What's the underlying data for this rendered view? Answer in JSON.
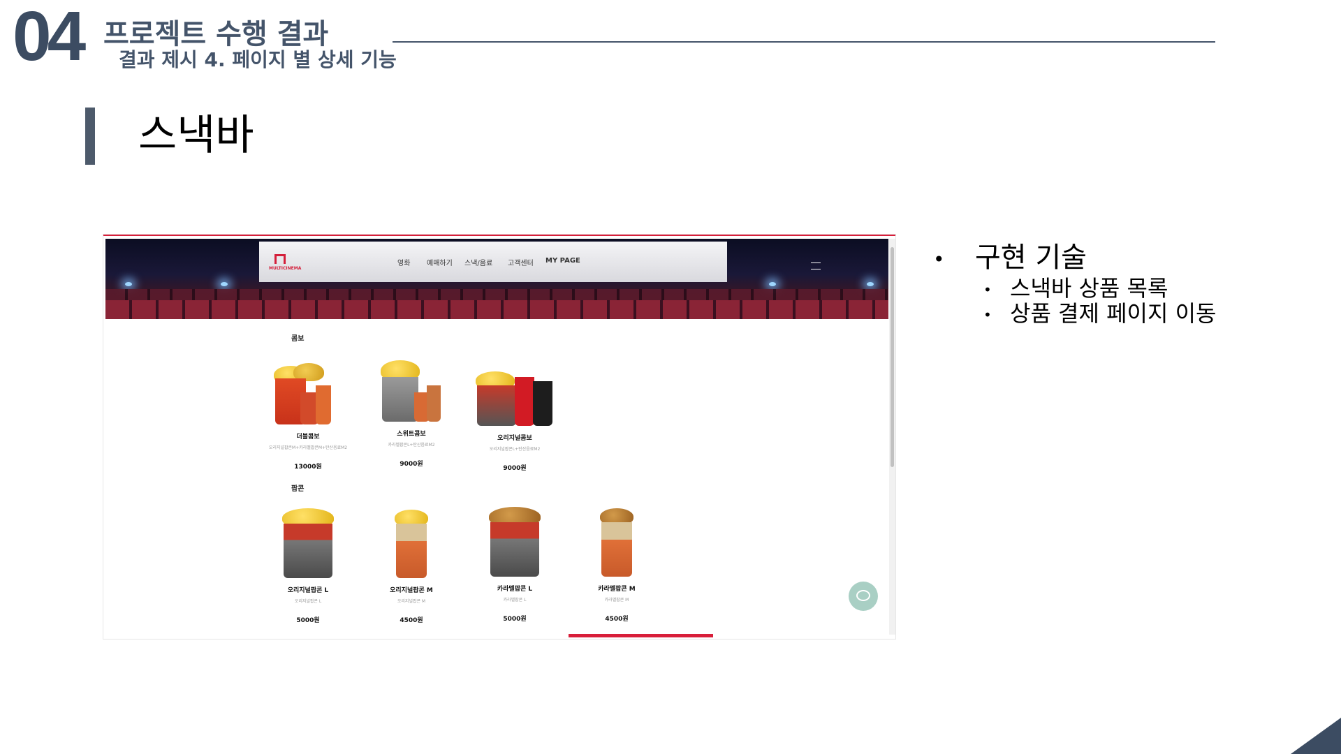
{
  "header": {
    "section_number": "04",
    "title": "프로젝트 수행 결과",
    "subtitle": "결과 제시 4. 페이지 별 상세 기능"
  },
  "page_title": "스낵바",
  "screenshot": {
    "logo": "MULTICINEMA",
    "nav": [
      "영화",
      "예매하기",
      "스낵/음료",
      "고객센터",
      "MY PAGE"
    ],
    "categories": [
      "콤보",
      "팝콘"
    ],
    "combo_products": [
      {
        "name": "더블콤보",
        "desc": "오리지널팝콘M+카라멜팝콘M+탄산음료M2",
        "price": "13000원"
      },
      {
        "name": "스위트콤보",
        "desc": "카라멜팝콘L+탄산음료M2",
        "price": "9000원"
      },
      {
        "name": "오리지널콤보",
        "desc": "오리지널팝콘L+탄산음료M2",
        "price": "9000원"
      }
    ],
    "popcorn_products": [
      {
        "name": "오리지널팝콘 L",
        "desc": "오리지널팝콘 L",
        "price": "5000원"
      },
      {
        "name": "오리지널팝콘 M",
        "desc": "오리지널팝콘 M",
        "price": "4500원"
      },
      {
        "name": "카라멜팝콘 L",
        "desc": "카라멜팝콘 L",
        "price": "5000원"
      },
      {
        "name": "카라멜팝콘 M",
        "desc": "카라멜팝콘 M",
        "price": "4500원"
      }
    ]
  },
  "bullets": {
    "main": "구현 기술",
    "items": [
      "스낵바 상품 목록",
      "상품 결제 페이지 이동"
    ]
  },
  "colors": {
    "accent": "#44546a",
    "brand_red": "#d81e3a",
    "chat": "#a9cfc4"
  }
}
